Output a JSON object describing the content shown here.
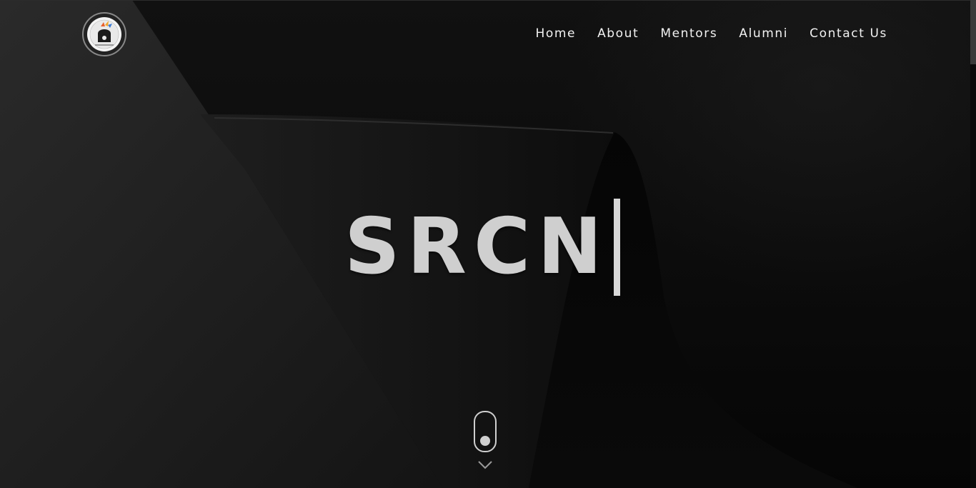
{
  "header": {
    "logo_alt": "logo",
    "nav": [
      {
        "label": "Home"
      },
      {
        "label": "About"
      },
      {
        "label": "Mentors"
      },
      {
        "label": "Alumni"
      },
      {
        "label": "Contact Us"
      }
    ]
  },
  "hero": {
    "title": "SRCN"
  },
  "scroll_indicator": {
    "icon": "mouse-scroll-icon",
    "arrow_icon": "chevron-down-icon"
  },
  "colors": {
    "background": "#0b0b0b",
    "nav_text": "#f2f2f2",
    "hero_text": "#cfcfcf"
  }
}
